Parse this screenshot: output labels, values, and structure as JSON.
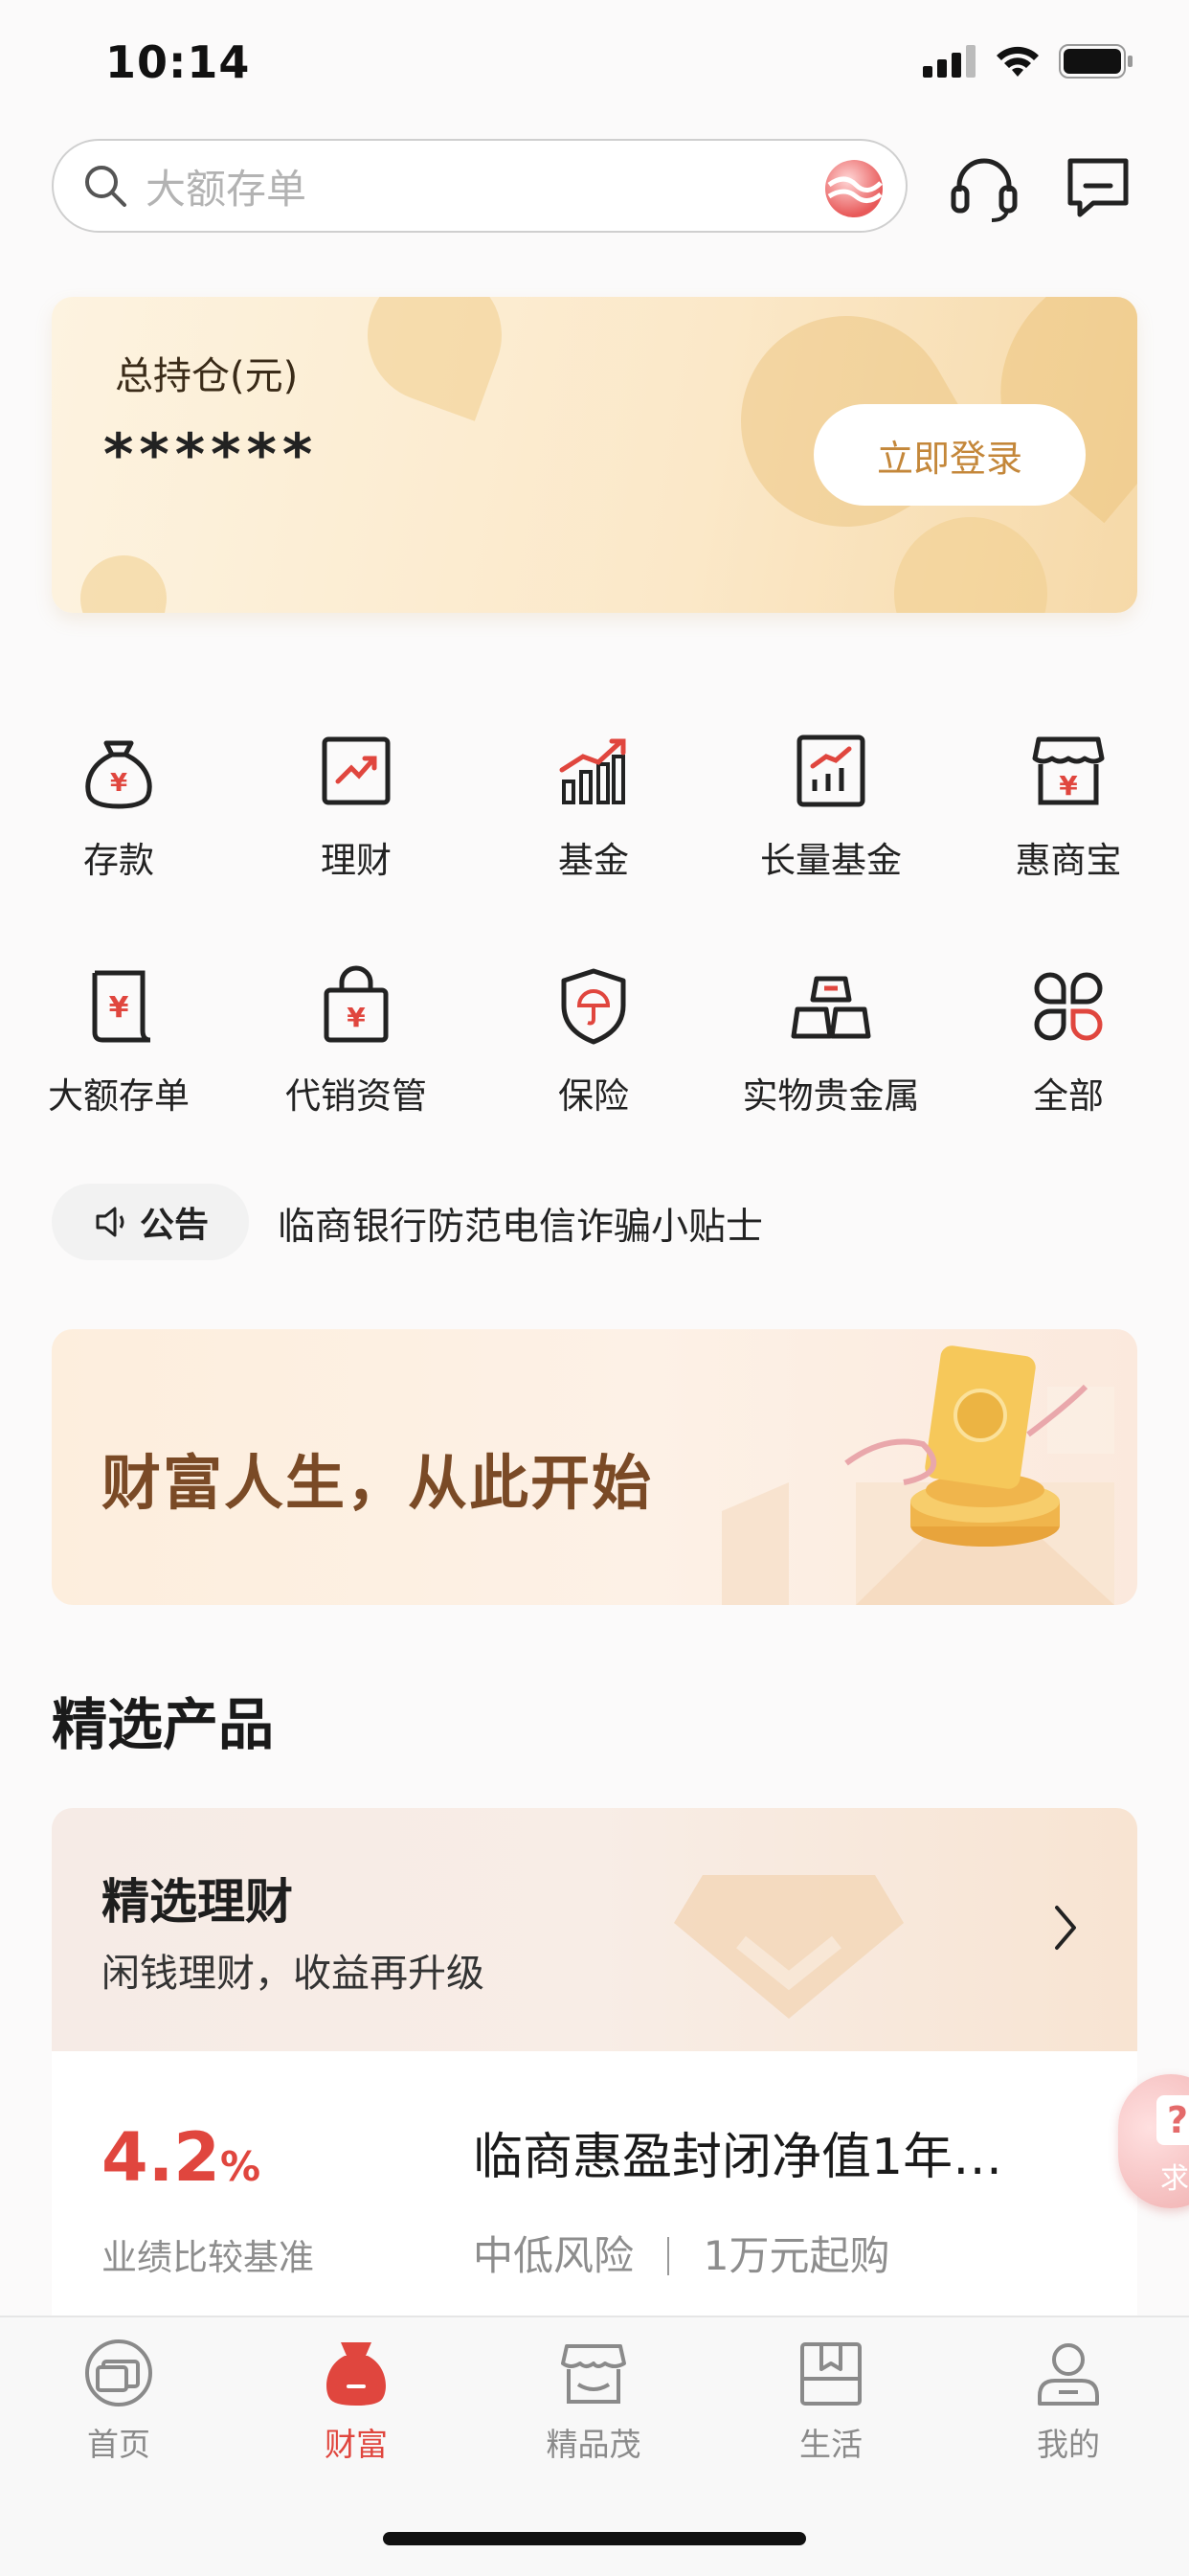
{
  "status_bar": {
    "time": "10:14"
  },
  "search": {
    "placeholder": "大额存单"
  },
  "holdings": {
    "title": "总持仓(元)",
    "value": "******",
    "login_label": "立即登录"
  },
  "grid": [
    {
      "label": "存款",
      "icon": "money-bag-icon"
    },
    {
      "label": "理财",
      "icon": "trend-chart-icon"
    },
    {
      "label": "基金",
      "icon": "bar-chart-icon"
    },
    {
      "label": "长量基金",
      "icon": "growth-board-icon"
    },
    {
      "label": "惠商宝",
      "icon": "shop-icon"
    },
    {
      "label": "大额存单",
      "icon": "scroll-icon"
    },
    {
      "label": "代销资管",
      "icon": "shopping-bag-icon"
    },
    {
      "label": "保险",
      "icon": "shield-umbrella-icon"
    },
    {
      "label": "实物贵金属",
      "icon": "gold-bars-icon"
    },
    {
      "label": "全部",
      "icon": "all-apps-icon"
    }
  ],
  "notice": {
    "tag": "公告",
    "text": "临商银行防范电信诈骗小贴士"
  },
  "banner": {
    "text": "财富人生，从此开始"
  },
  "section": {
    "title": "精选产品"
  },
  "product_card": {
    "title": "精选理财",
    "subtitle": "闲钱理财，收益再升级",
    "rate": "4.2",
    "rate_unit": "%",
    "rate_label": "业绩比较基准",
    "name": "临商惠盈封闭净值1年…",
    "risk": "中低风险",
    "min_buy": "1万元起购"
  },
  "float_help": {
    "glyph": "?",
    "text": "求"
  },
  "tabbar": [
    {
      "label": "首页",
      "active": false
    },
    {
      "label": "财富",
      "active": true
    },
    {
      "label": "精品茂",
      "active": false
    },
    {
      "label": "生活",
      "active": false
    },
    {
      "label": "我的",
      "active": false
    }
  ],
  "colors": {
    "accent": "#e0463e",
    "gold": "#c4873a",
    "banner_text": "#7a4a26"
  }
}
